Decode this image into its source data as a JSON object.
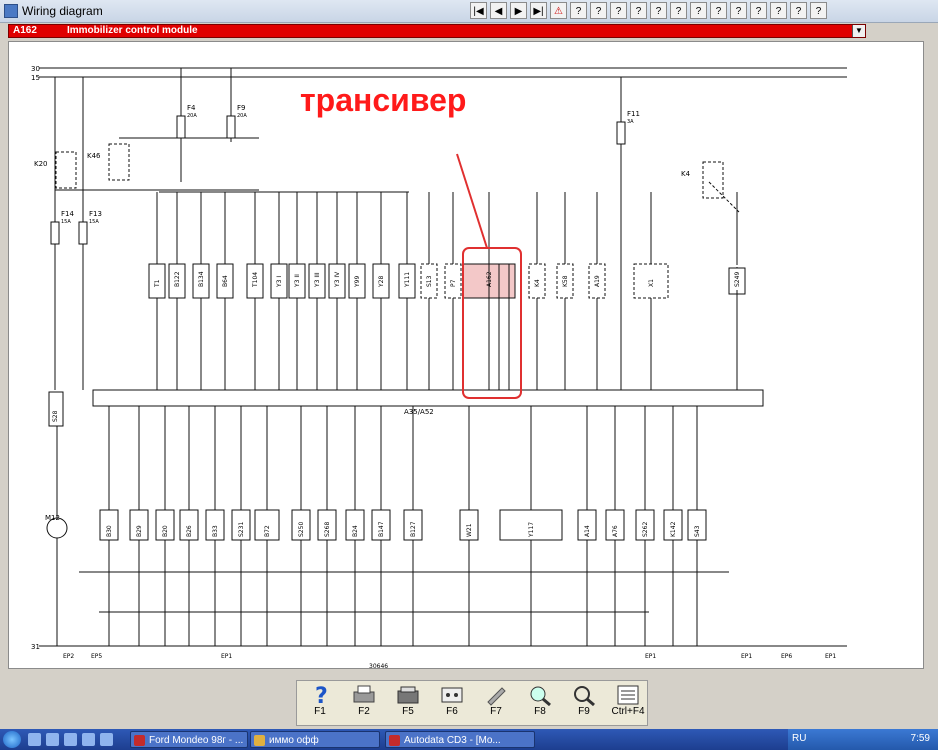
{
  "window": {
    "title": "Wiring diagram"
  },
  "module": {
    "code": "A162",
    "name": "Immobilizer control module"
  },
  "diagram": {
    "annotation": "трансивер",
    "rail_labels": [
      "30",
      "15",
      "31"
    ],
    "fuses": [
      {
        "id": "F4",
        "rating": "20A"
      },
      {
        "id": "F9",
        "rating": "20A"
      },
      {
        "id": "F11",
        "rating": "3A"
      },
      {
        "id": "F14",
        "rating": "15A"
      },
      {
        "id": "F13",
        "rating": "15A"
      }
    ],
    "top_components": [
      "T1",
      "B122",
      "B134",
      "B64",
      "T104",
      "Y3 I",
      "Y3 II",
      "Y3 III",
      "Y3 IV",
      "Y99",
      "Y28",
      "Y111",
      "S13",
      "P7",
      "A162",
      "K4",
      "K58",
      "A19",
      "X1",
      "S249"
    ],
    "bottom_components": [
      "B30",
      "B29",
      "B20",
      "B26",
      "B33",
      "S231",
      "B72",
      "S250",
      "S268",
      "B24",
      "B147",
      "B127",
      "W21",
      "Y117",
      "A14",
      "A76",
      "S262",
      "K142",
      "S43"
    ],
    "relays": [
      "K20",
      "K46",
      "K4"
    ],
    "motor": "M12",
    "sensor_left": "S28",
    "connector": "A35/A52",
    "bottom_code": "30646",
    "grounds": [
      "EP2",
      "EP5",
      "EP1",
      "EP1",
      "EP1",
      "EP6",
      "EP1"
    ]
  },
  "toolbar_buttons": [
    "|◀",
    "◀",
    "▶",
    "▶|",
    "⚠",
    "?",
    "?",
    "?",
    "?",
    "?",
    "?",
    "?",
    "?",
    "?",
    "?",
    "?",
    "?",
    "?"
  ],
  "fkeys": [
    {
      "label": "F1",
      "icon": "help-icon"
    },
    {
      "label": "F2",
      "icon": "print-icon"
    },
    {
      "label": "F5",
      "icon": "printer-icon"
    },
    {
      "label": "F6",
      "icon": "connector-icon"
    },
    {
      "label": "F7",
      "icon": "wrench-icon"
    },
    {
      "label": "F8",
      "icon": "zoom-diagram-icon"
    },
    {
      "label": "F9",
      "icon": "magnify-icon"
    },
    {
      "label": "Ctrl+F4",
      "icon": "list-icon"
    }
  ],
  "taskbar": {
    "items": [
      {
        "label": "Ford Mondeo 98г - ...",
        "color": "#c42b2b"
      },
      {
        "label": "иммо офф",
        "color": "#e0b040"
      },
      {
        "label": "Autodata CD3 - [Mo...",
        "color": "#c42b2b"
      }
    ],
    "lang": "RU",
    "time": "7:59"
  },
  "colors": {
    "module_bar": "#e00000",
    "annotation": "#ff1a1a",
    "highlight": "#e03030",
    "taskbar": "#2450b0"
  }
}
